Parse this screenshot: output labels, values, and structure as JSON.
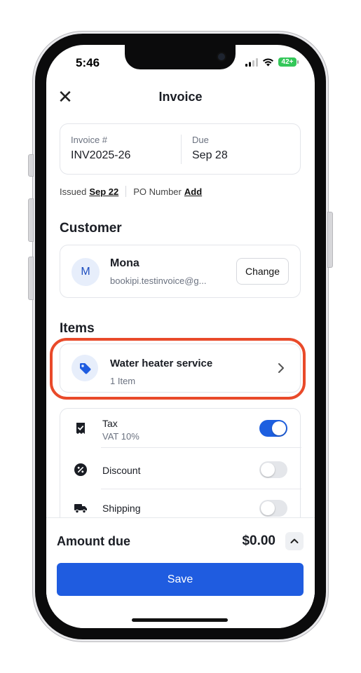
{
  "status_bar": {
    "time": "5:46",
    "battery": "42+"
  },
  "header": {
    "title": "Invoice",
    "close_label": "✕"
  },
  "invoice": {
    "number_label": "Invoice #",
    "number_value": "INV2025-26",
    "due_label": "Due",
    "due_value": "Sep 28"
  },
  "meta": {
    "issued_label": "Issued",
    "issued_value": "Sep 22",
    "po_label": "PO Number",
    "po_action": "Add"
  },
  "customer": {
    "section_title": "Customer",
    "avatar_initial": "M",
    "name": "Mona",
    "email": "bookipi.testinvoice@g...",
    "change_label": "Change"
  },
  "items": {
    "section_title": "Items",
    "item_name": "Water heater service",
    "item_count": "1 Item"
  },
  "options": [
    {
      "label": "Tax",
      "sub": "VAT 10%",
      "on": true,
      "icon": "receipt-icon"
    },
    {
      "label": "Discount",
      "sub": "",
      "on": false,
      "icon": "percent-icon"
    },
    {
      "label": "Shipping",
      "sub": "",
      "on": false,
      "icon": "truck-icon"
    }
  ],
  "footer": {
    "amount_label": "Amount due",
    "amount_value": "$0.00",
    "save_label": "Save"
  },
  "colors": {
    "primary": "#1f5ce0",
    "highlight": "#e94a2a",
    "battery": "#34c759"
  }
}
